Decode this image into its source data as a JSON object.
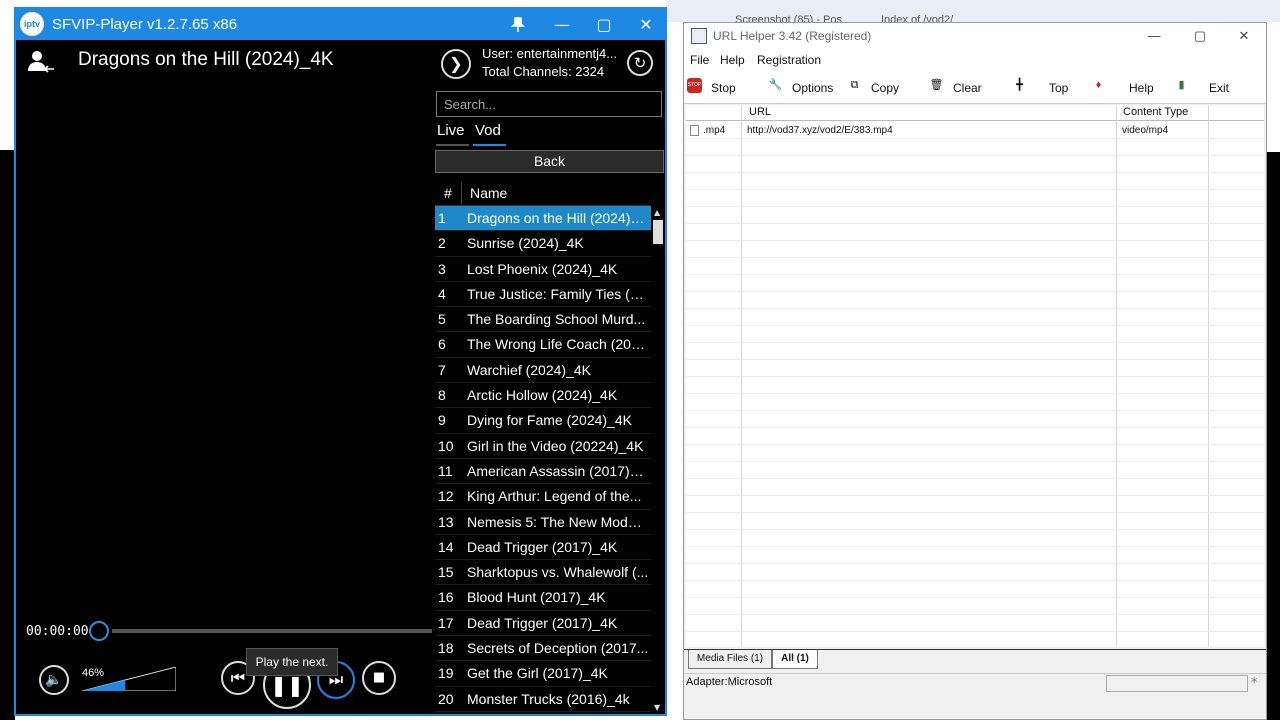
{
  "sfvip": {
    "window_title": "SFVIP-Player v1.2.7.65 x86",
    "logo_text": "iptv",
    "now_playing": "Dragons on the Hill  (2024)_4K",
    "user_line": "User: entertainmentj4...",
    "channels_line": "Total Channels: 2324",
    "search_placeholder": "Search...",
    "tabs": {
      "live": "Live",
      "vod": "Vod"
    },
    "back_label": "Back",
    "list_header": {
      "num": "#",
      "name": "Name"
    },
    "items": [
      {
        "num": "1",
        "name": "Dragons on the Hill  (2024)_4K"
      },
      {
        "num": "2",
        "name": "Sunrise  (2024)_4K"
      },
      {
        "num": "3",
        "name": "Lost Phoenix  (2024)_4K"
      },
      {
        "num": "4",
        "name": "True Justice: Family Ties  (20..."
      },
      {
        "num": "5",
        "name": "The Boarding School Murd..."
      },
      {
        "num": "6",
        "name": "The Wrong Life Coach  (202..."
      },
      {
        "num": "7",
        "name": "Warchief  (2024)_4K"
      },
      {
        "num": "8",
        "name": "Arctic Hollow  (2024)_4K"
      },
      {
        "num": "9",
        "name": "Dying for Fame  (2024)_4K"
      },
      {
        "num": "10",
        "name": "Girl in the Video  (20224)_4K"
      },
      {
        "num": "11",
        "name": "American Assassin  (2017)_4K"
      },
      {
        "num": "12",
        "name": "King Arthur: Legend of the..."
      },
      {
        "num": "13",
        "name": "Nemesis 5: The New Model..."
      },
      {
        "num": "14",
        "name": "Dead Trigger  (2017)_4K"
      },
      {
        "num": "15",
        "name": "Sharktopus vs. Whalewolf  (..."
      },
      {
        "num": "16",
        "name": "Blood Hunt  (2017)_4K"
      },
      {
        "num": "17",
        "name": "Dead Trigger  (2017)_4K"
      },
      {
        "num": "18",
        "name": "Secrets of Deception  (2017..."
      },
      {
        "num": "19",
        "name": "Get the Girl  (2017)_4K"
      },
      {
        "num": "20",
        "name": "Monster Trucks  (2016)_4k"
      }
    ],
    "time": "00:00:00",
    "volume_label": "46%",
    "volume_level": 0.46,
    "tooltip": "Play the next."
  },
  "urlhelper": {
    "title": "URL Helper 3.42 (Registered)",
    "menu": {
      "file": "File",
      "help": "Help",
      "registration": "Registration"
    },
    "toolbar": {
      "stop": "Stop",
      "options": "Options",
      "copy": "Copy",
      "clear": "Clear",
      "top": "Top",
      "help": "Help",
      "exit": "Exit"
    },
    "columns": {
      "url": "URL",
      "content_type": "Content Type"
    },
    "rows": [
      {
        "ext": ".mp4",
        "url": "http://vod37.xyz/vod2/E/383.mp4",
        "type": "video/mp4"
      }
    ],
    "tabs": {
      "media": "Media Files (1)",
      "all": "All (1)"
    },
    "status": "Adapter:Microsoft"
  },
  "background": {
    "tab1": "Screenshot (85) - Pos",
    "tab2": "Index of /vod2/"
  }
}
